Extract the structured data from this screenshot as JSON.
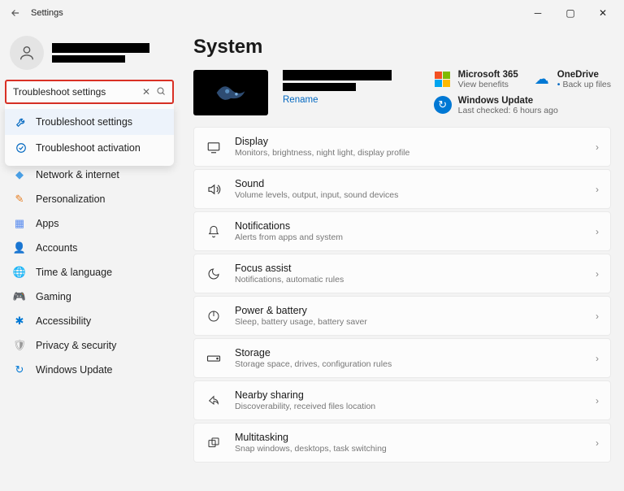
{
  "app": {
    "title": "Settings"
  },
  "search": {
    "value": "Troubleshoot settings"
  },
  "suggestions": [
    {
      "label": "Troubleshoot settings"
    },
    {
      "label": "Troubleshoot activation"
    }
  ],
  "nav": [
    {
      "label": "Network & internet"
    },
    {
      "label": "Personalization"
    },
    {
      "label": "Apps"
    },
    {
      "label": "Accounts"
    },
    {
      "label": "Time & language"
    },
    {
      "label": "Gaming"
    },
    {
      "label": "Accessibility"
    },
    {
      "label": "Privacy & security"
    },
    {
      "label": "Windows Update"
    }
  ],
  "page": {
    "title": "System"
  },
  "device": {
    "rename": "Rename"
  },
  "cards": {
    "m365": {
      "title": "Microsoft 365",
      "sub": "View benefits"
    },
    "onedrive": {
      "title": "OneDrive",
      "sub": "Back up files"
    },
    "wu": {
      "title": "Windows Update",
      "sub": "Last checked: 6 hours ago"
    }
  },
  "settings": [
    {
      "title": "Display",
      "sub": "Monitors, brightness, night light, display profile"
    },
    {
      "title": "Sound",
      "sub": "Volume levels, output, input, sound devices"
    },
    {
      "title": "Notifications",
      "sub": "Alerts from apps and system"
    },
    {
      "title": "Focus assist",
      "sub": "Notifications, automatic rules"
    },
    {
      "title": "Power & battery",
      "sub": "Sleep, battery usage, battery saver"
    },
    {
      "title": "Storage",
      "sub": "Storage space, drives, configuration rules"
    },
    {
      "title": "Nearby sharing",
      "sub": "Discoverability, received files location"
    },
    {
      "title": "Multitasking",
      "sub": "Snap windows, desktops, task switching"
    }
  ]
}
